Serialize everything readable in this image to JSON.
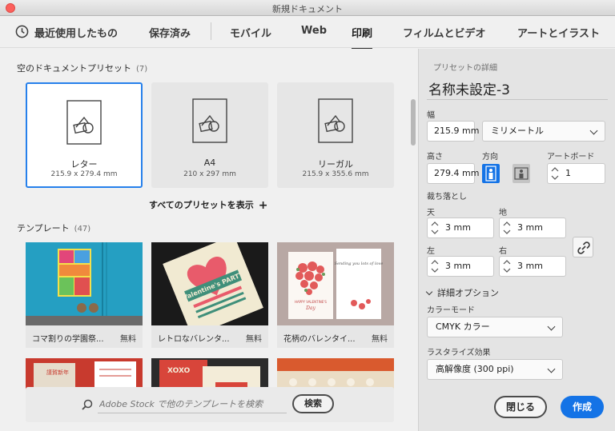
{
  "window": {
    "title": "新規ドキュメント"
  },
  "tabs": [
    {
      "label": "最近使用したもの",
      "active": false
    },
    {
      "label": "保存済み",
      "active": false
    },
    {
      "label": "モバイル",
      "active": false
    },
    {
      "label": "Web",
      "active": false
    },
    {
      "label": "印刷",
      "active": true
    },
    {
      "label": "フィルムとビデオ",
      "active": false
    },
    {
      "label": "アートとイラスト",
      "active": false
    }
  ],
  "presets": {
    "heading": "空のドキュメントプリセット",
    "count": "(7)",
    "items": [
      {
        "name": "レター",
        "size": "215.9 x 279.4 mm",
        "selected": true
      },
      {
        "name": "A4",
        "size": "210 x 297 mm",
        "selected": false
      },
      {
        "name": "リーガル",
        "size": "215.9 x 355.6 mm",
        "selected": false
      }
    ],
    "show_all": "すべてのプリセットを表示"
  },
  "templates": {
    "heading": "テンプレート",
    "count": "(47)",
    "items": [
      {
        "caption": "コマ割りの学園祭...",
        "price": "無料"
      },
      {
        "caption": "レトロなバレンタ...",
        "price": "無料"
      },
      {
        "caption": "花柄のバレンタイ...",
        "price": "無料"
      }
    ],
    "thumb_text": {
      "valentine_party": "Valentine's PARTY",
      "happy_valentines": "HAPPY VALENTINE'S",
      "day": "Day",
      "sending_love": "Sending you lots of love",
      "xoxo": "XOXO",
      "new_year": "謹賀新年"
    }
  },
  "search": {
    "placeholder": "Adobe Stock で他のテンプレートを検索",
    "button": "検索"
  },
  "details": {
    "heading": "プリセットの詳細",
    "name": "名称未設定-3",
    "width_label": "幅",
    "width_value": "215.9 mm",
    "unit": "ミリメートル",
    "height_label": "高さ",
    "height_value": "279.4 mm",
    "orientation_label": "方向",
    "artboards_label": "アートボード",
    "artboards_value": "1",
    "bleed_label": "裁ち落とし",
    "bleed_top_label": "天",
    "bleed_top": "3 mm",
    "bleed_bottom_label": "地",
    "bleed_bottom": "3 mm",
    "bleed_left_label": "左",
    "bleed_left": "3 mm",
    "bleed_right_label": "右",
    "bleed_right": "3 mm",
    "advanced_label": "詳細オプション",
    "color_mode_label": "カラーモード",
    "color_mode": "CMYK カラー",
    "raster_label": "ラスタライズ効果",
    "raster": "高解像度 (300 ppi)",
    "close": "閉じる",
    "create": "作成"
  },
  "colors": {
    "accent": "#1473e6",
    "selected_border": "#2680eb"
  },
  "icons": [
    "clock-icon",
    "plus-icon",
    "search-icon",
    "portrait-icon",
    "landscape-icon",
    "link-icon",
    "chevron-down-icon"
  ]
}
